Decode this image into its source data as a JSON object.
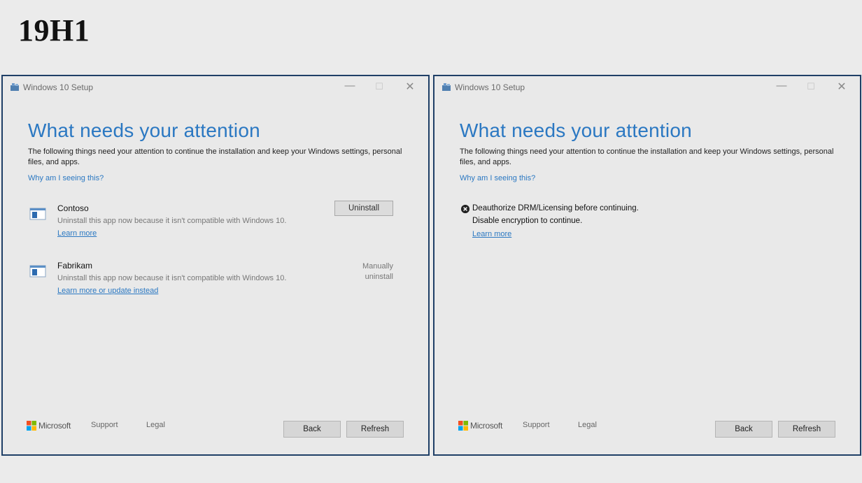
{
  "slide": {
    "title": "19H1"
  },
  "windows": [
    {
      "title": "Windows 10 Setup",
      "heading": "What needs your attention",
      "description": "The following things need your attention to continue the installation and keep your Windows settings, personal files, and apps.",
      "why_link": "Why am I seeing this?",
      "items": [
        {
          "name": "Contoso",
          "message": "Uninstall this app now because it isn't compatible with Windows 10.",
          "link": "Learn more",
          "action_button": "Uninstall"
        },
        {
          "name": "Fabrikam",
          "message": "Uninstall this app now because it isn't compatible with Windows 10.",
          "link": "Learn more or update instead",
          "action_text_line1": "Manually",
          "action_text_line2": "uninstall"
        }
      ],
      "footer": {
        "brand": "Microsoft",
        "support": "Support",
        "legal": "Legal",
        "back": "Back",
        "refresh": "Refresh"
      }
    },
    {
      "title": "Windows 10 Setup",
      "heading": "What needs your attention",
      "description": "The following things need your attention to continue the installation and keep your Windows settings, personal files, and apps.",
      "why_link": "Why am I seeing this?",
      "issue": {
        "line1": "Deauthorize DRM/Licensing before continuing.",
        "line2": "Disable encryption to continue.",
        "link": "Learn more"
      },
      "footer": {
        "brand": "Microsoft",
        "support": "Support",
        "legal": "Legal",
        "back": "Back",
        "refresh": "Refresh"
      }
    }
  ],
  "icons": {
    "app": "setup-app-icon",
    "item": "app-window-icon",
    "error": "error-x-icon",
    "brand": "microsoft-logo-icon"
  },
  "colors": {
    "accent": "#2b78c2",
    "window_border": "#1f3f66",
    "background": "#ebebeb"
  }
}
